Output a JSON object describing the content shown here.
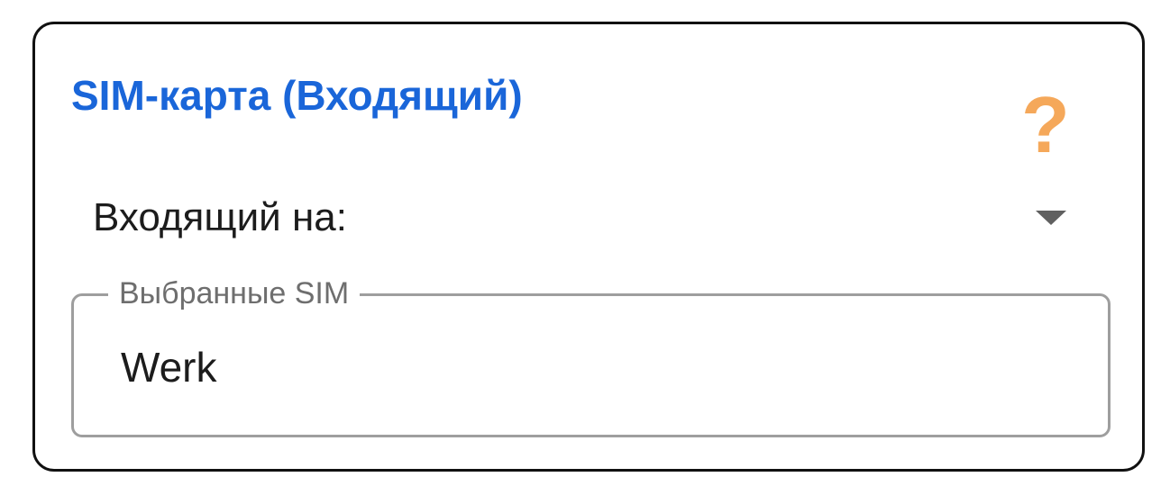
{
  "card": {
    "title": "SIM-карта (Входящий)",
    "help_icon": "question-mark-icon",
    "dropdown": {
      "label": "Входящий на:",
      "icon": "chevron-down-icon"
    },
    "selected_sim_field": {
      "legend": "Выбранные SIM",
      "value": "Werk"
    }
  },
  "colors": {
    "title": "#1a66d9",
    "help_icon": "#f5a85a",
    "border": "#111111",
    "field_border": "#9e9e9e"
  }
}
